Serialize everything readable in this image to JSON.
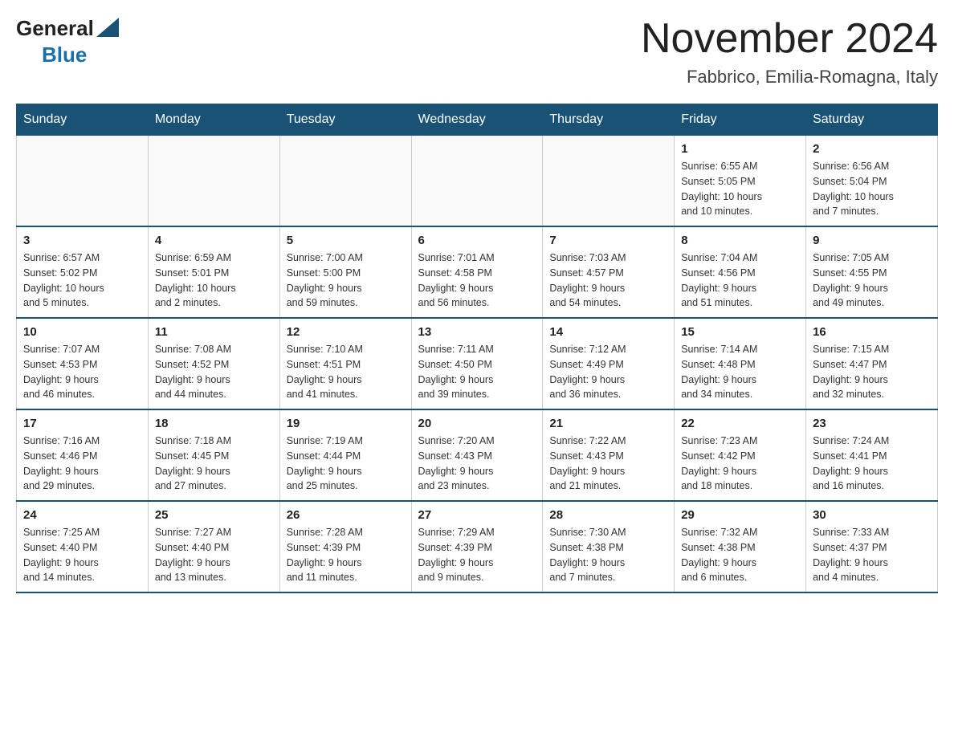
{
  "header": {
    "logo_general": "General",
    "logo_blue": "Blue",
    "month_title": "November 2024",
    "location": "Fabbrico, Emilia-Romagna, Italy"
  },
  "days_of_week": [
    "Sunday",
    "Monday",
    "Tuesday",
    "Wednesday",
    "Thursday",
    "Friday",
    "Saturday"
  ],
  "weeks": [
    [
      {
        "day": "",
        "info": ""
      },
      {
        "day": "",
        "info": ""
      },
      {
        "day": "",
        "info": ""
      },
      {
        "day": "",
        "info": ""
      },
      {
        "day": "",
        "info": ""
      },
      {
        "day": "1",
        "info": "Sunrise: 6:55 AM\nSunset: 5:05 PM\nDaylight: 10 hours\nand 10 minutes."
      },
      {
        "day": "2",
        "info": "Sunrise: 6:56 AM\nSunset: 5:04 PM\nDaylight: 10 hours\nand 7 minutes."
      }
    ],
    [
      {
        "day": "3",
        "info": "Sunrise: 6:57 AM\nSunset: 5:02 PM\nDaylight: 10 hours\nand 5 minutes."
      },
      {
        "day": "4",
        "info": "Sunrise: 6:59 AM\nSunset: 5:01 PM\nDaylight: 10 hours\nand 2 minutes."
      },
      {
        "day": "5",
        "info": "Sunrise: 7:00 AM\nSunset: 5:00 PM\nDaylight: 9 hours\nand 59 minutes."
      },
      {
        "day": "6",
        "info": "Sunrise: 7:01 AM\nSunset: 4:58 PM\nDaylight: 9 hours\nand 56 minutes."
      },
      {
        "day": "7",
        "info": "Sunrise: 7:03 AM\nSunset: 4:57 PM\nDaylight: 9 hours\nand 54 minutes."
      },
      {
        "day": "8",
        "info": "Sunrise: 7:04 AM\nSunset: 4:56 PM\nDaylight: 9 hours\nand 51 minutes."
      },
      {
        "day": "9",
        "info": "Sunrise: 7:05 AM\nSunset: 4:55 PM\nDaylight: 9 hours\nand 49 minutes."
      }
    ],
    [
      {
        "day": "10",
        "info": "Sunrise: 7:07 AM\nSunset: 4:53 PM\nDaylight: 9 hours\nand 46 minutes."
      },
      {
        "day": "11",
        "info": "Sunrise: 7:08 AM\nSunset: 4:52 PM\nDaylight: 9 hours\nand 44 minutes."
      },
      {
        "day": "12",
        "info": "Sunrise: 7:10 AM\nSunset: 4:51 PM\nDaylight: 9 hours\nand 41 minutes."
      },
      {
        "day": "13",
        "info": "Sunrise: 7:11 AM\nSunset: 4:50 PM\nDaylight: 9 hours\nand 39 minutes."
      },
      {
        "day": "14",
        "info": "Sunrise: 7:12 AM\nSunset: 4:49 PM\nDaylight: 9 hours\nand 36 minutes."
      },
      {
        "day": "15",
        "info": "Sunrise: 7:14 AM\nSunset: 4:48 PM\nDaylight: 9 hours\nand 34 minutes."
      },
      {
        "day": "16",
        "info": "Sunrise: 7:15 AM\nSunset: 4:47 PM\nDaylight: 9 hours\nand 32 minutes."
      }
    ],
    [
      {
        "day": "17",
        "info": "Sunrise: 7:16 AM\nSunset: 4:46 PM\nDaylight: 9 hours\nand 29 minutes."
      },
      {
        "day": "18",
        "info": "Sunrise: 7:18 AM\nSunset: 4:45 PM\nDaylight: 9 hours\nand 27 minutes."
      },
      {
        "day": "19",
        "info": "Sunrise: 7:19 AM\nSunset: 4:44 PM\nDaylight: 9 hours\nand 25 minutes."
      },
      {
        "day": "20",
        "info": "Sunrise: 7:20 AM\nSunset: 4:43 PM\nDaylight: 9 hours\nand 23 minutes."
      },
      {
        "day": "21",
        "info": "Sunrise: 7:22 AM\nSunset: 4:43 PM\nDaylight: 9 hours\nand 21 minutes."
      },
      {
        "day": "22",
        "info": "Sunrise: 7:23 AM\nSunset: 4:42 PM\nDaylight: 9 hours\nand 18 minutes."
      },
      {
        "day": "23",
        "info": "Sunrise: 7:24 AM\nSunset: 4:41 PM\nDaylight: 9 hours\nand 16 minutes."
      }
    ],
    [
      {
        "day": "24",
        "info": "Sunrise: 7:25 AM\nSunset: 4:40 PM\nDaylight: 9 hours\nand 14 minutes."
      },
      {
        "day": "25",
        "info": "Sunrise: 7:27 AM\nSunset: 4:40 PM\nDaylight: 9 hours\nand 13 minutes."
      },
      {
        "day": "26",
        "info": "Sunrise: 7:28 AM\nSunset: 4:39 PM\nDaylight: 9 hours\nand 11 minutes."
      },
      {
        "day": "27",
        "info": "Sunrise: 7:29 AM\nSunset: 4:39 PM\nDaylight: 9 hours\nand 9 minutes."
      },
      {
        "day": "28",
        "info": "Sunrise: 7:30 AM\nSunset: 4:38 PM\nDaylight: 9 hours\nand 7 minutes."
      },
      {
        "day": "29",
        "info": "Sunrise: 7:32 AM\nSunset: 4:38 PM\nDaylight: 9 hours\nand 6 minutes."
      },
      {
        "day": "30",
        "info": "Sunrise: 7:33 AM\nSunset: 4:37 PM\nDaylight: 9 hours\nand 4 minutes."
      }
    ]
  ]
}
